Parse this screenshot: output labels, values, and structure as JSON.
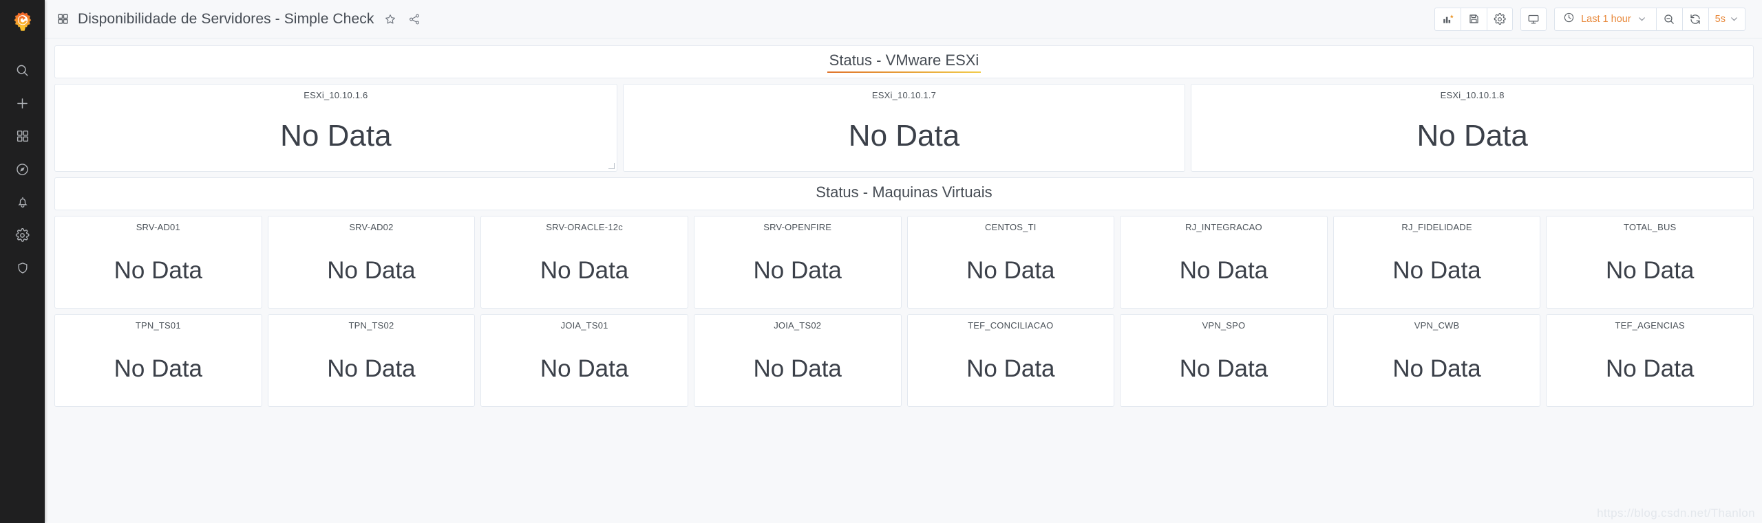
{
  "app": {
    "brand_color": "#e8883a",
    "sidebar_bg": "#1f1f20",
    "body_bg": "#f7f8fa"
  },
  "sidebar": {
    "logo_name": "grafana-logo",
    "items": [
      {
        "name": "search-icon",
        "label": "Search"
      },
      {
        "name": "plus-icon",
        "label": "Create"
      },
      {
        "name": "dashboards-icon",
        "label": "Dashboards"
      },
      {
        "name": "explore-compass-icon",
        "label": "Explore"
      },
      {
        "name": "alert-bell-icon",
        "label": "Alerting"
      },
      {
        "name": "gear-icon",
        "label": "Configuration"
      },
      {
        "name": "shield-icon",
        "label": "Server Admin"
      }
    ]
  },
  "header": {
    "dashboard_icon": "dashboard-grid-icon",
    "title": "Disponibilidade de Servidores - Simple Check",
    "star_icon": "star-icon",
    "share_icon": "share-icon",
    "toolbar": {
      "add_panel_label": "add-panel",
      "save_label": "save-dashboard",
      "settings_label": "dashboard-settings",
      "tv_label": "cycle-view-mode",
      "time_range": "Last 1 hour",
      "zoom_out_label": "zoom-out-time-range",
      "refresh_label": "refresh-dashboard",
      "refresh_interval": "5s"
    }
  },
  "dashboard": {
    "rows": [
      {
        "title": "Status - VMware ESXi",
        "underlined": true,
        "kind": "esxi",
        "panels": [
          {
            "title": "ESXi_10.10.1.6",
            "value": "No Data",
            "resize_handle": true
          },
          {
            "title": "ESXi_10.10.1.7",
            "value": "No Data",
            "resize_handle": false
          },
          {
            "title": "ESXi_10.10.1.8",
            "value": "No Data",
            "resize_handle": false
          }
        ]
      },
      {
        "title": "Status - Maquinas Virtuais",
        "underlined": false,
        "kind": "vms",
        "panels": [
          {
            "title": "SRV-AD01",
            "value": "No Data",
            "resize_handle": false
          },
          {
            "title": "SRV-AD02",
            "value": "No Data",
            "resize_handle": false
          },
          {
            "title": "SRV-ORACLE-12c",
            "value": "No Data",
            "resize_handle": false
          },
          {
            "title": "SRV-OPENFIRE",
            "value": "No Data",
            "resize_handle": false
          },
          {
            "title": "CENTOS_TI",
            "value": "No Data",
            "resize_handle": false
          },
          {
            "title": "RJ_INTEGRACAO",
            "value": "No Data",
            "resize_handle": false
          },
          {
            "title": "RJ_FIDELIDADE",
            "value": "No Data",
            "resize_handle": false
          },
          {
            "title": "TOTAL_BUS",
            "value": "No Data",
            "resize_handle": false
          }
        ]
      },
      {
        "title": null,
        "underlined": false,
        "kind": "vms",
        "panels": [
          {
            "title": "TPN_TS01",
            "value": "No Data",
            "resize_handle": false
          },
          {
            "title": "TPN_TS02",
            "value": "No Data",
            "resize_handle": false
          },
          {
            "title": "JOIA_TS01",
            "value": "No Data",
            "resize_handle": false
          },
          {
            "title": "JOIA_TS02",
            "value": "No Data",
            "resize_handle": false
          },
          {
            "title": "TEF_CONCILIACAO",
            "value": "No Data",
            "resize_handle": false
          },
          {
            "title": "VPN_SPO",
            "value": "No Data",
            "resize_handle": false
          },
          {
            "title": "VPN_CWB",
            "value": "No Data",
            "resize_handle": false
          },
          {
            "title": "TEF_AGENCIAS",
            "value": "No Data",
            "resize_handle": false
          }
        ]
      }
    ]
  },
  "watermark": "https://blog.csdn.net/Thanlon"
}
